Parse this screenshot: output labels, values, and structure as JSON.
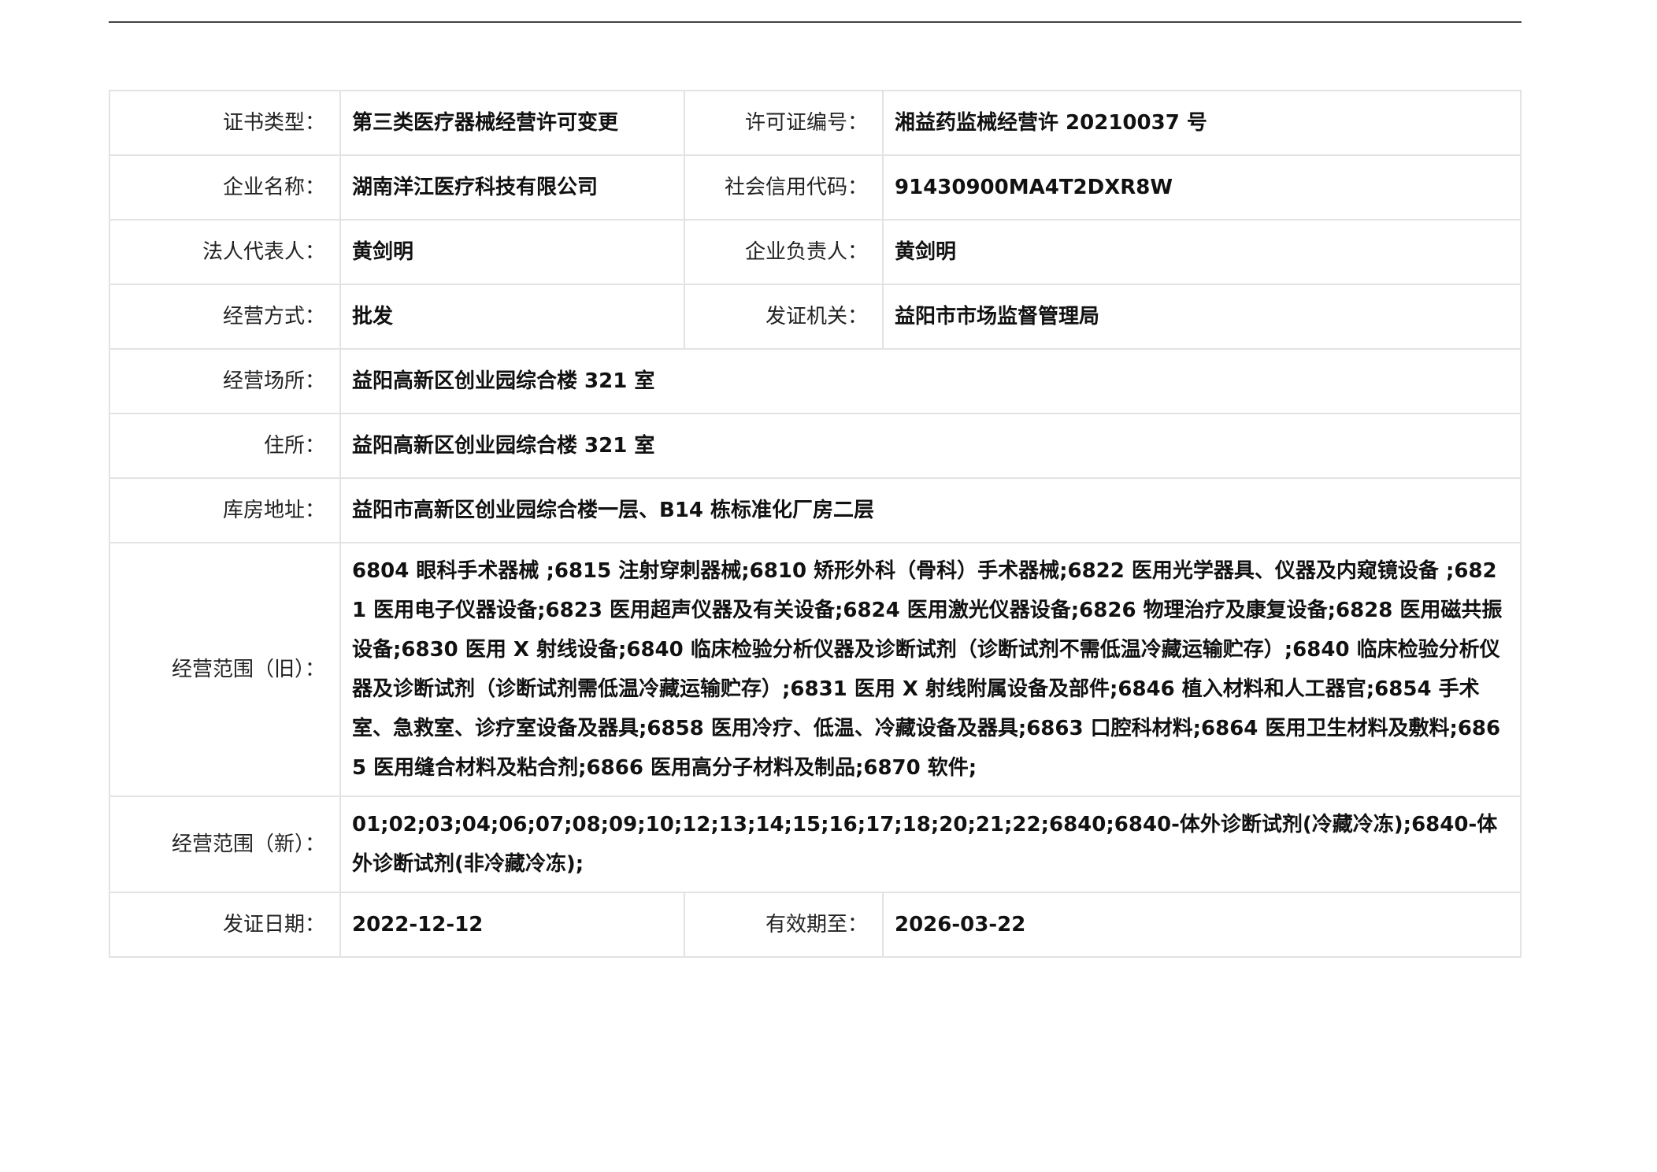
{
  "certificate": {
    "cert_type": {
      "label": "证书类型：",
      "value": "第三类医疗器械经营许可变更"
    },
    "license_no": {
      "label": "许可证编号：",
      "value": "湘益药监械经营许 20210037 号"
    },
    "company_name": {
      "label": "企业名称：",
      "value": "湖南洋江医疗科技有限公司"
    },
    "credit_code": {
      "label": "社会信用代码：",
      "value": "91430900MA4T2DXR8W"
    },
    "legal_rep": {
      "label": "法人代表人：",
      "value": "黄剑明"
    },
    "manager": {
      "label": "企业负责人：",
      "value": "黄剑明"
    },
    "business_mode": {
      "label": "经营方式：",
      "value": "批发"
    },
    "issuing_authority": {
      "label": "发证机关：",
      "value": "益阳市市场监督管理局"
    },
    "business_place": {
      "label": "经营场所：",
      "value": "益阳高新区创业园综合楼 321 室"
    },
    "residence": {
      "label": "住所：",
      "value": "益阳高新区创业园综合楼 321 室"
    },
    "warehouse_address": {
      "label": "库房地址：",
      "value": "益阳市高新区创业园综合楼一层、B14 栋标准化厂房二层"
    },
    "scope_old": {
      "label": "经营范围（旧）：",
      "value": "6804 眼科手术器械 ;6815 注射穿刺器械;6810 矫形外科（骨科）手术器械;6822 医用光学器具、仪器及内窥镜设备 ;6821 医用电子仪器设备;6823 医用超声仪器及有关设备;6824 医用激光仪器设备;6826 物理治疗及康复设备;6828 医用磁共振设备;6830 医用 X 射线设备;6840 临床检验分析仪器及诊断试剂（诊断试剂不需低温冷藏运输贮存）;6840 临床检验分析仪器及诊断试剂（诊断试剂需低温冷藏运输贮存）;6831 医用 X 射线附属设备及部件;6846 植入材料和人工器官;6854 手术室、急救室、诊疗室设备及器具;6858 医用冷疗、低温、冷藏设备及器具;6863 口腔科材料;6864 医用卫生材料及敷料;6865 医用缝合材料及粘合剂;6866 医用高分子材料及制品;6870 软件;"
    },
    "scope_new": {
      "label": "经营范围（新）：",
      "value": "01;02;03;04;06;07;08;09;10;12;13;14;15;16;17;18;20;21;22;6840;6840-体外诊断试剂(冷藏冷冻);6840-体外诊断试剂(非冷藏冷冻);"
    },
    "issue_date": {
      "label": "发证日期：",
      "value": "2022-12-12"
    },
    "valid_until": {
      "label": "有效期至：",
      "value": "2026-03-22"
    }
  }
}
